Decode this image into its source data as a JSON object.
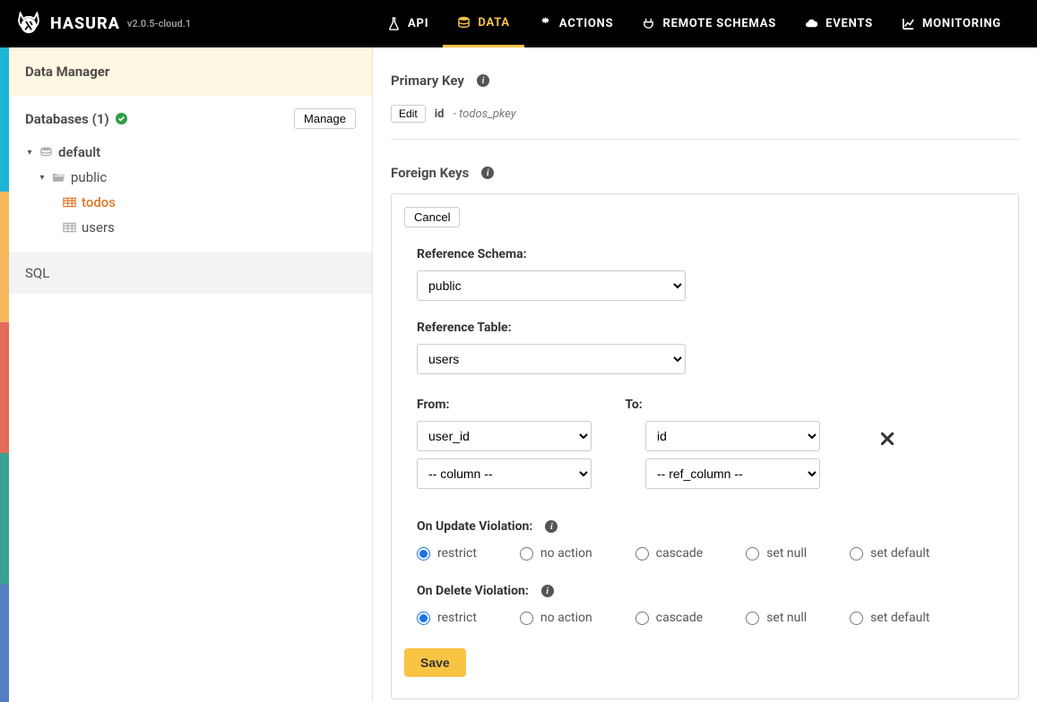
{
  "topbar": {
    "brand": "HASURA",
    "version": "v2.0.5-cloud.1",
    "nav": {
      "api": "API",
      "data": "DATA",
      "actions": "ACTIONS",
      "remote": "REMOTE SCHEMAS",
      "events": "EVENTS",
      "monitoring": "MONITORING"
    }
  },
  "sidebar": {
    "header": "Data Manager",
    "databases_label": "Databases (1)",
    "manage": "Manage",
    "tree": {
      "db": "default",
      "schema": "public",
      "t1": "todos",
      "t2": "users"
    },
    "sql": "SQL"
  },
  "pk": {
    "title": "Primary Key",
    "edit": "Edit",
    "col": "id",
    "sep": " - ",
    "name": "todos_pkey"
  },
  "fk": {
    "title": "Foreign Keys",
    "cancel": "Cancel",
    "ref_schema_label": "Reference Schema:",
    "ref_schema": "public",
    "ref_table_label": "Reference Table:",
    "ref_table": "users",
    "from_label": "From:",
    "to_label": "To:",
    "from1": "user_id",
    "to1": "id",
    "from_placeholder": "-- column --",
    "to_placeholder": "-- ref_column --",
    "on_update_label": "On Update Violation:",
    "on_delete_label": "On Delete Violation:",
    "opts": {
      "restrict": "restrict",
      "noaction": "no action",
      "cascade": "cascade",
      "setnull": "set null",
      "setdefault": "set default"
    },
    "save": "Save"
  }
}
